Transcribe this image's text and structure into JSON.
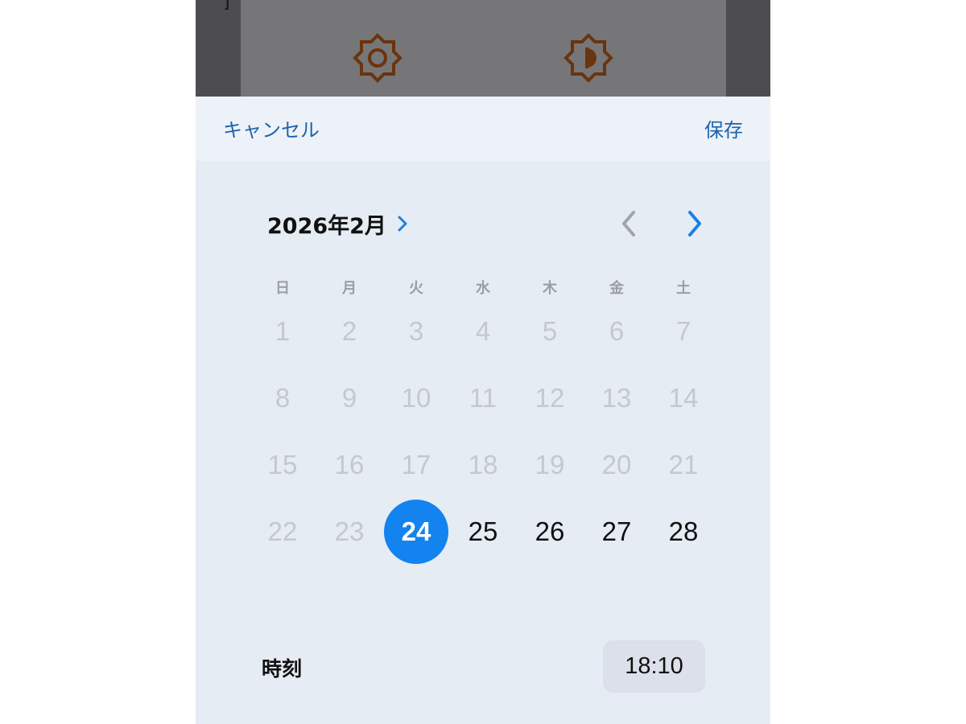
{
  "background": {
    "corner_text": "]"
  },
  "header": {
    "cancel_label": "キャンセル",
    "save_label": "保存"
  },
  "calendar": {
    "month_title": "2026年2月",
    "weekdays": [
      "日",
      "月",
      "火",
      "水",
      "木",
      "金",
      "土"
    ],
    "weeks": [
      [
        "1",
        "2",
        "3",
        "4",
        "5",
        "6",
        "7"
      ],
      [
        "8",
        "9",
        "10",
        "11",
        "12",
        "13",
        "14"
      ],
      [
        "15",
        "16",
        "17",
        "18",
        "19",
        "20",
        "21"
      ],
      [
        "22",
        "23",
        "24",
        "25",
        "26",
        "27",
        "28"
      ]
    ],
    "selected_day": "24",
    "first_selectable_day": "24",
    "accent_color": "#1283ef"
  },
  "time": {
    "label": "時刻",
    "value": "18:10"
  },
  "icons": {
    "bg_left": "brightness-sun-icon",
    "bg_right": "contrast-half-sun-icon"
  }
}
